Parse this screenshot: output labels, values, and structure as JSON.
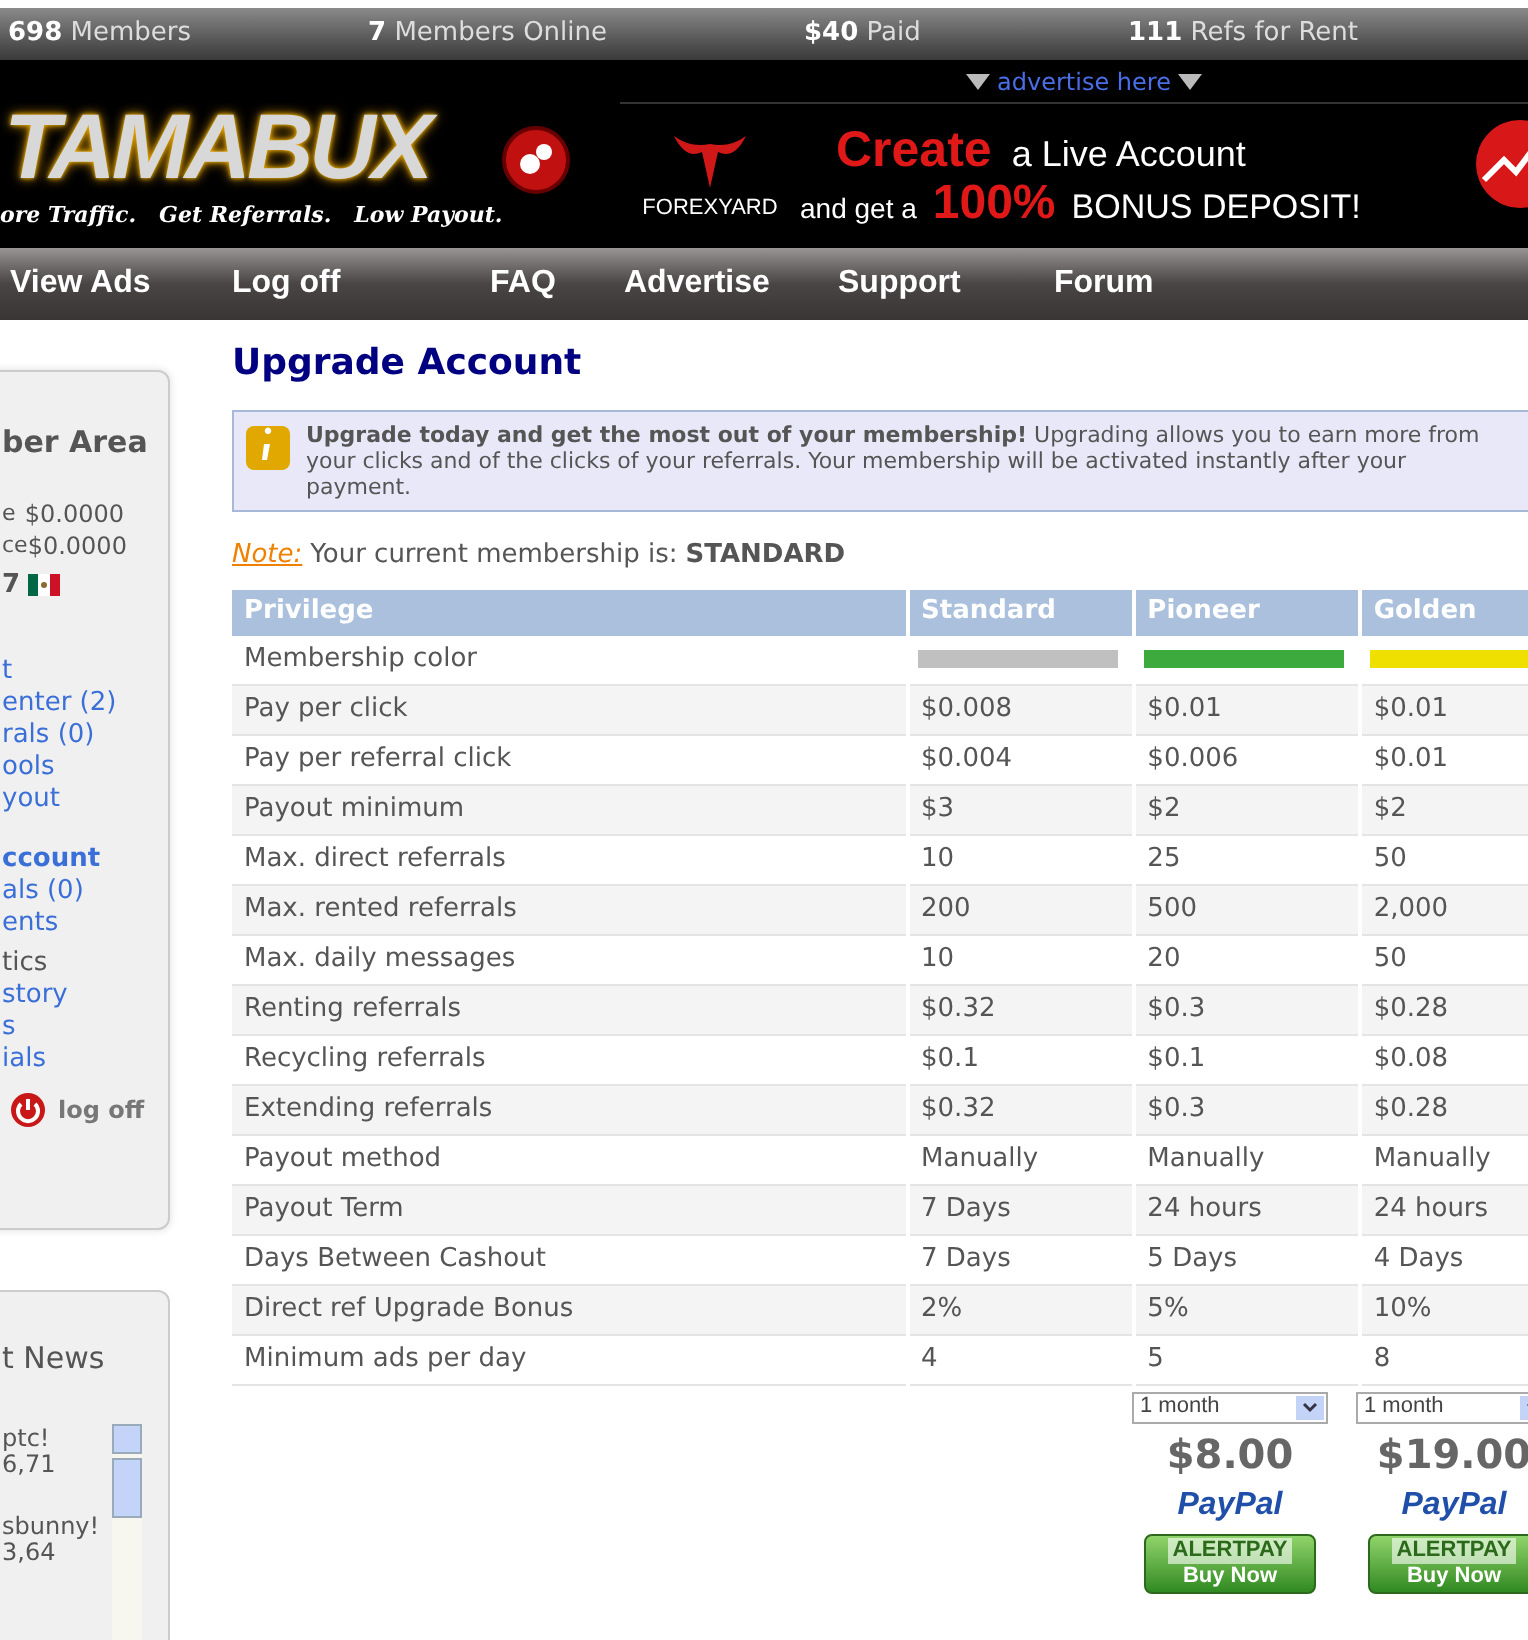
{
  "stats_bar": [
    {
      "value": "698",
      "label": "Members"
    },
    {
      "value": "7",
      "label": "Members Online"
    },
    {
      "value": "$40",
      "label": "Paid"
    },
    {
      "value": "111",
      "label": "Refs for Rent"
    }
  ],
  "header": {
    "logo": "TAMABUX",
    "tagline": "ore Traffic.   Get Referrals.   Low Payout.",
    "advertise_link": "advertise here",
    "ad": {
      "brand": "FOREXYARD",
      "headline": "Create",
      "line_1": "a Live Account",
      "line_2": "and get a",
      "highlight": "100%",
      "line_3": "BONUS DEPOSIT!"
    }
  },
  "nav": [
    "View Ads",
    "Log off",
    "FAQ",
    "Advertise",
    "Support",
    "Forum"
  ],
  "sidebar": {
    "title": "ber Area",
    "balances": [
      {
        "label": "e",
        "value": "$0.0000"
      },
      {
        "label": "ce",
        "value": "$0.0000"
      }
    ],
    "country_code": "7",
    "items": [
      {
        "text": "t",
        "kind": "link"
      },
      {
        "text": "enter (2)",
        "kind": "link"
      },
      {
        "text": "rals (0)",
        "kind": "link"
      },
      {
        "text": "ools",
        "kind": "link"
      },
      {
        "text": "yout",
        "kind": "link"
      },
      {
        "text": "ccount",
        "kind": "current"
      },
      {
        "text": "als (0)",
        "kind": "link"
      },
      {
        "text": "ents",
        "kind": "link"
      },
      {
        "text": "tics",
        "kind": "text"
      },
      {
        "text": "story",
        "kind": "link"
      },
      {
        "text": "s",
        "kind": "link"
      },
      {
        "text": "ials",
        "kind": "link"
      }
    ],
    "logoff": "log off"
  },
  "news": {
    "title": "t News",
    "entries": [
      {
        "line_1": "ptc!",
        "line_2": "6,71"
      },
      {
        "line_1": "sbunny!",
        "line_2": "3,64"
      }
    ]
  },
  "page_title": "Upgrade Account",
  "info_box": "**Upgrade today and get the most out of your membership!** Upgrading allows you to earn more from your clicks and of the clicks of your referrals. Your membership will be activated instantly after your payment.",
  "note": {
    "label": "Note:",
    "text": "Your current membership is:",
    "value": "STANDARD"
  },
  "table": {
    "columns": [
      {
        "name": "Privilege"
      },
      {
        "name": "Standard",
        "color": "#c0c0c0"
      },
      {
        "name": "Pioneer",
        "color": "#3caa3c"
      },
      {
        "name": "Golden",
        "color": "#f0e000"
      }
    ],
    "color_row_label": "Membership color",
    "rows": [
      {
        "label": "Pay per click",
        "values": [
          "$0.008",
          "$0.01",
          "$0.01"
        ]
      },
      {
        "label": "Pay per referral click",
        "values": [
          "$0.004",
          "$0.006",
          "$0.01"
        ]
      },
      {
        "label": "Payout minimum",
        "values": [
          "$3",
          "$2",
          "$2"
        ]
      },
      {
        "label": "Max. direct referrals",
        "values": [
          "10",
          "25",
          "50"
        ]
      },
      {
        "label": "Max. rented referrals",
        "values": [
          "200",
          "500",
          "2,000"
        ]
      },
      {
        "label": "Max. daily messages",
        "values": [
          "10",
          "20",
          "50"
        ]
      },
      {
        "label": "Renting referrals",
        "values": [
          "$0.32",
          "$0.3",
          "$0.28"
        ]
      },
      {
        "label": "Recycling referrals",
        "values": [
          "$0.1",
          "$0.1",
          "$0.08"
        ]
      },
      {
        "label": "Extending referrals",
        "values": [
          "$0.32",
          "$0.3",
          "$0.28"
        ]
      },
      {
        "label": "Payout method",
        "values": [
          "Manually",
          "Manually",
          "Manually"
        ]
      },
      {
        "label": "Payout Term",
        "values": [
          "7 Days",
          "24 hours",
          "24 hours"
        ]
      },
      {
        "label": "Days Between Cashout",
        "values": [
          "7 Days",
          "5 Days",
          "4 Days"
        ]
      },
      {
        "label": "Direct ref Upgrade Bonus",
        "values": [
          "2%",
          "5%",
          "10%"
        ]
      },
      {
        "label": "Minimum ads per day",
        "values": [
          "4",
          "5",
          "8"
        ]
      }
    ]
  },
  "plans": [
    {
      "period": "1 month",
      "price": "$8.00",
      "paypal": "PayPal",
      "alertpay": "ALERTPAY",
      "buy": "Buy Now"
    },
    {
      "period": "1 month",
      "price": "$19.00",
      "paypal": "PayPal",
      "alertpay": "ALERTPAY",
      "buy": "Buy Now"
    }
  ]
}
